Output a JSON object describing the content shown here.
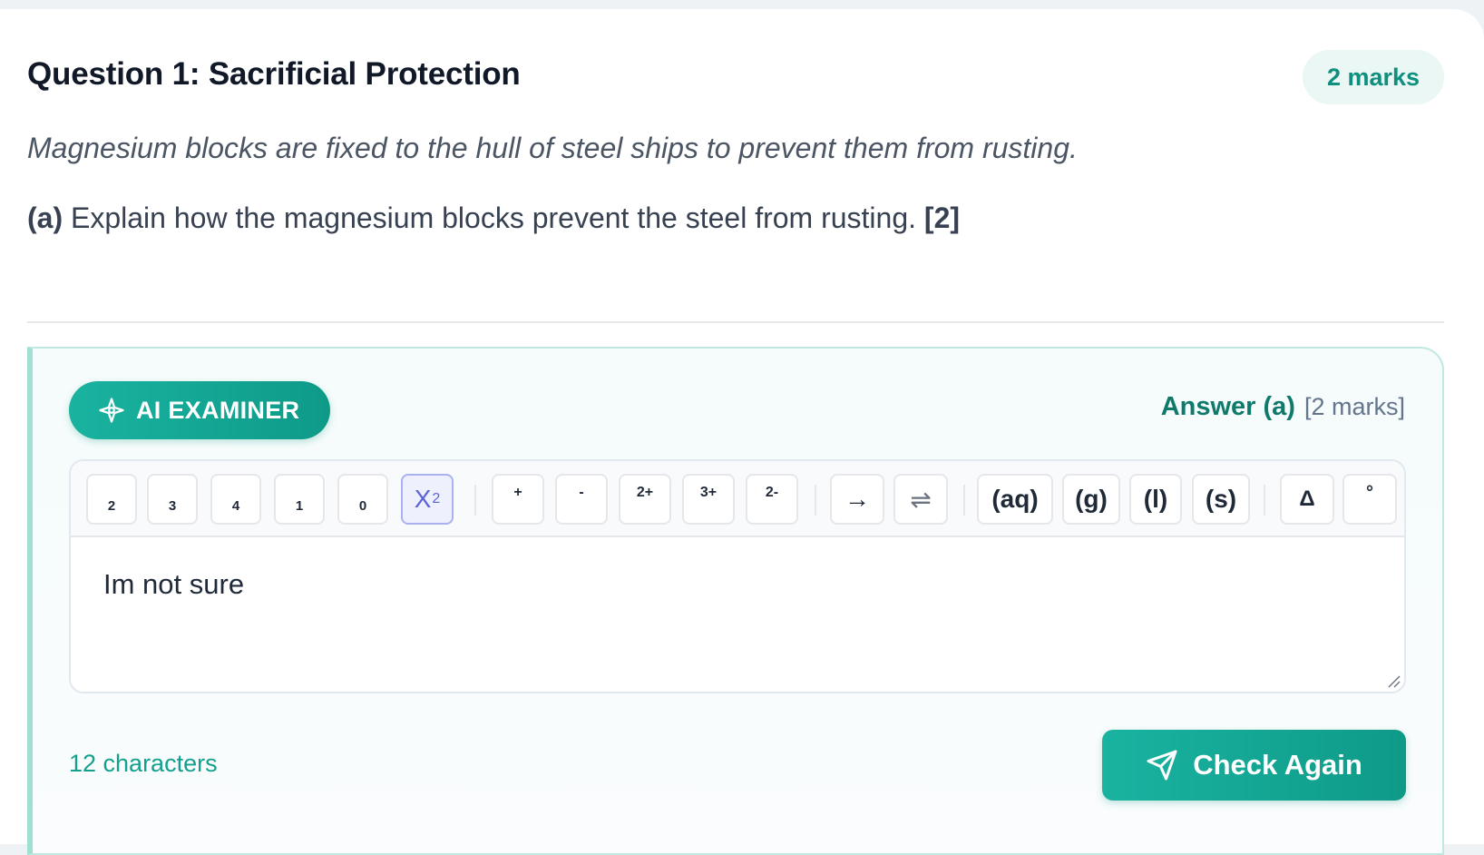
{
  "question": {
    "title": "Question 1: Sacrificial Protection",
    "marks_badge": "2 marks",
    "context": "Magnesium blocks are fixed to the hull of steel ships to prevent them from rusting.",
    "part_label": "(a)",
    "part_text": "Explain how the magnesium blocks prevent the steel from rusting.",
    "part_marks": "[2]"
  },
  "examiner": {
    "badge_label": "AI EXAMINER",
    "answer_label": "Answer (a)",
    "answer_marks": "[2 marks]"
  },
  "toolbar": {
    "buttons": [
      "2",
      "3",
      "4",
      "1",
      "0",
      "X",
      "+",
      "-",
      "2+",
      "3+",
      "2-",
      "→",
      "⇌",
      "(aq)",
      "(g)",
      "(l)",
      "(s)",
      "Δ",
      "°"
    ],
    "subscript_toggle_sub": "2"
  },
  "answer": {
    "text": "Im not sure",
    "char_count": "12 characters"
  },
  "actions": {
    "check_label": "Check Again"
  },
  "colors": {
    "accent": "#14a08e",
    "accent_dark": "#0f7a6c",
    "active_tool": "#5b63d6"
  }
}
